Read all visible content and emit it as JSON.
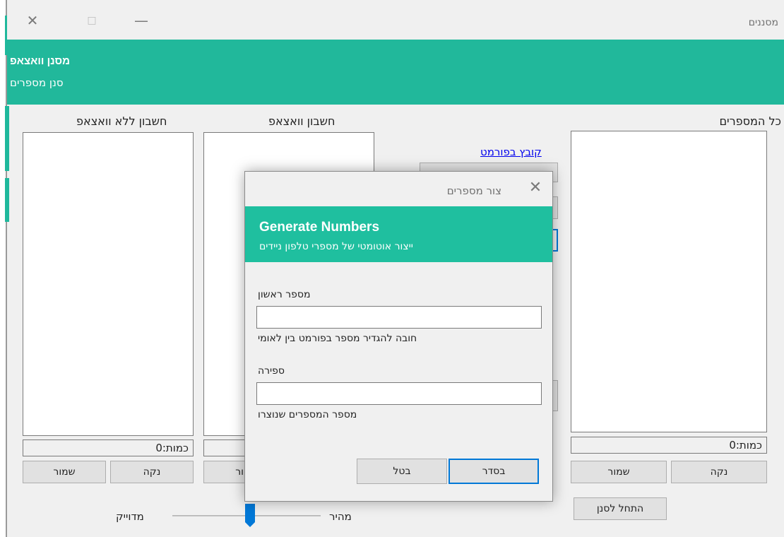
{
  "window": {
    "title": "מסננים"
  },
  "header": {
    "title": "מסנן וואצאפ",
    "subtitle": "סנן מספרים"
  },
  "columns": {
    "all": {
      "label": "כל המספרים",
      "count": "כמות:0",
      "clean": "נקה",
      "save": "שמור"
    },
    "whatsapp": {
      "label": "חשבון וואצאפ",
      "count": "",
      "save_partial": "ור"
    },
    "no_whatsapp": {
      "label": "חשבון ללא וואצאפ",
      "count": "כמות:0",
      "clean": "נקה",
      "save": "שמור"
    }
  },
  "format_link": "קובץ בפורמט",
  "start_button": "התחל לסנן",
  "slider": {
    "fast": "מהיר",
    "accurate": "מדוייק"
  },
  "dialog": {
    "title": "צור מספרים",
    "heading": "Generate Numbers",
    "subheading": "ייצור אוטומטי של מספרי טלפון ניידים",
    "first_number_label": "מספר ראשון",
    "first_number_value": "",
    "first_number_hint": "חובה להגדיר מספר בפורמט בין לאומי",
    "count_label": "ספירה",
    "count_value": "",
    "count_hint": "מספר המספרים שנוצרו",
    "ok": "בסדר",
    "cancel": "בטל"
  },
  "colors": {
    "accent": "#21b89b",
    "slider_thumb": "#0078d7"
  }
}
